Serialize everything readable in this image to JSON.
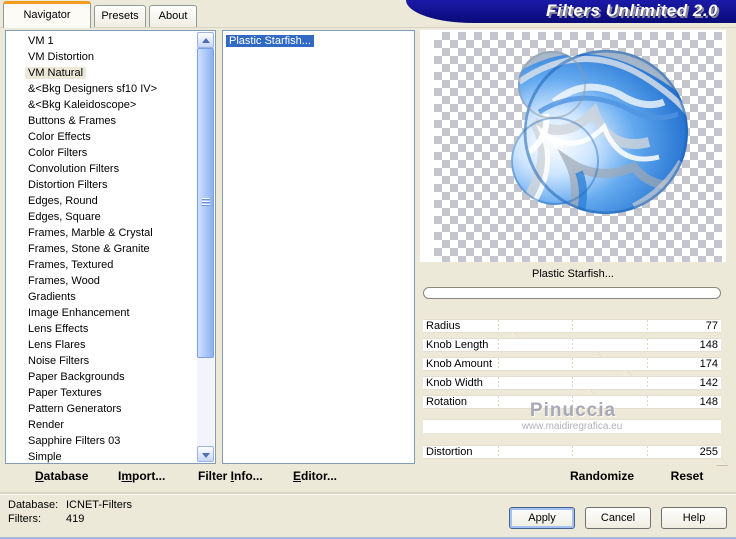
{
  "window": {
    "title": "Filters Unlimited 2.0"
  },
  "tabs": {
    "navigator": "Navigator",
    "presets": "Presets",
    "about": "About"
  },
  "categories": {
    "selected": "VM Natural",
    "items": [
      "VM 1",
      "VM Distortion",
      "VM Natural",
      "&<Bkg Designers sf10 IV>",
      "&<Bkg Kaleidoscope>",
      "Buttons & Frames",
      "Color Effects",
      "Color Filters",
      "Convolution Filters",
      "Distortion Filters",
      "Edges, Round",
      "Edges, Square",
      "Frames, Marble & Crystal",
      "Frames, Stone & Granite",
      "Frames, Textured",
      "Frames, Wood",
      "Gradients",
      "Image Enhancement",
      "Lens Effects",
      "Lens Flares",
      "Noise Filters",
      "Paper Backgrounds",
      "Paper Textures",
      "Pattern Generators",
      "Render",
      "Sapphire Filters 03",
      "Simple"
    ]
  },
  "filters_list": {
    "selected": "Plastic Starfish...",
    "items": [
      "Plastic Starfish..."
    ]
  },
  "preview": {
    "filter_name": "Plastic Starfish...",
    "progress_percent": 0
  },
  "slider_max": 255,
  "sliders": [
    {
      "label": "Radius",
      "value": 77
    },
    {
      "label": "Knob Length",
      "value": 148
    },
    {
      "label": "Knob Amount",
      "value": 174
    },
    {
      "label": "Knob Width",
      "value": 142
    },
    {
      "label": "Rotation",
      "value": 148
    },
    {
      "label": "Distortion",
      "value": 255
    }
  ],
  "watermark": {
    "line1": "Pinuccia",
    "line2": "www.maidiregrafica.eu"
  },
  "toolbar": {
    "items": [
      {
        "label": "Database",
        "underline": 0
      },
      {
        "label": "Import...",
        "underline": 1
      },
      {
        "label": "Filter Info...",
        "underline": 7
      },
      {
        "label": "Editor...",
        "underline": 0
      }
    ]
  },
  "panel_actions": {
    "randomize": "Randomize",
    "reset": "Reset"
  },
  "status": {
    "database_label": "Database:",
    "database_value": "ICNET-Filters",
    "filters_label": "Filters:",
    "filters_value": "419"
  },
  "buttons": {
    "apply": "Apply",
    "cancel": "Cancel",
    "help": "Help"
  },
  "colors": {
    "dialog_bg": "#ece9d8",
    "banner_navy": "#10109a",
    "selection_blue": "#316ac5",
    "inactive_selection": "#ece9d8",
    "checker_gray": "#c5c5cd",
    "blob_blue": "#2b78d4",
    "thumb_cream": "#f0ead9",
    "tab_accent_orange": "#f49b21"
  }
}
